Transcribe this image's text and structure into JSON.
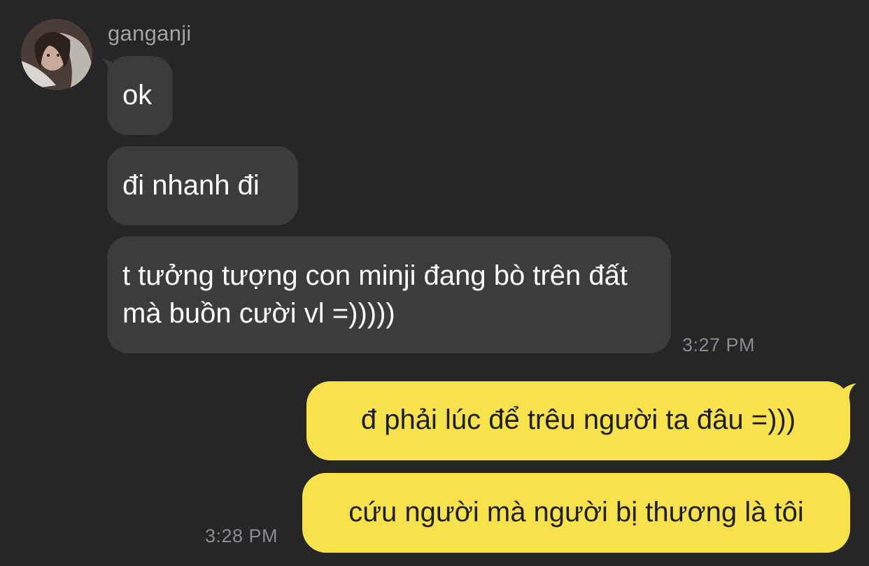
{
  "conversation": {
    "sender_name": "ganganji",
    "incoming": [
      {
        "text": "ok"
      },
      {
        "text": "đi nhanh đi"
      },
      {
        "text": "t tưởng tượng con minji đang bò trên đất mà buồn cười vl =)))))"
      }
    ],
    "incoming_time": "3:27 PM",
    "outgoing": [
      {
        "text": "đ phải lúc để trêu người ta đâu =)))"
      },
      {
        "text": "cứu người mà người bị thương là tôi"
      }
    ],
    "outgoing_time": "3:28 PM"
  },
  "colors": {
    "background": "#262628",
    "incoming_bubble": "#3c3c3e",
    "outgoing_bubble": "#f8e24c",
    "timestamp": "#8c8c90"
  },
  "icons": {
    "avatar": "profile-photo"
  }
}
